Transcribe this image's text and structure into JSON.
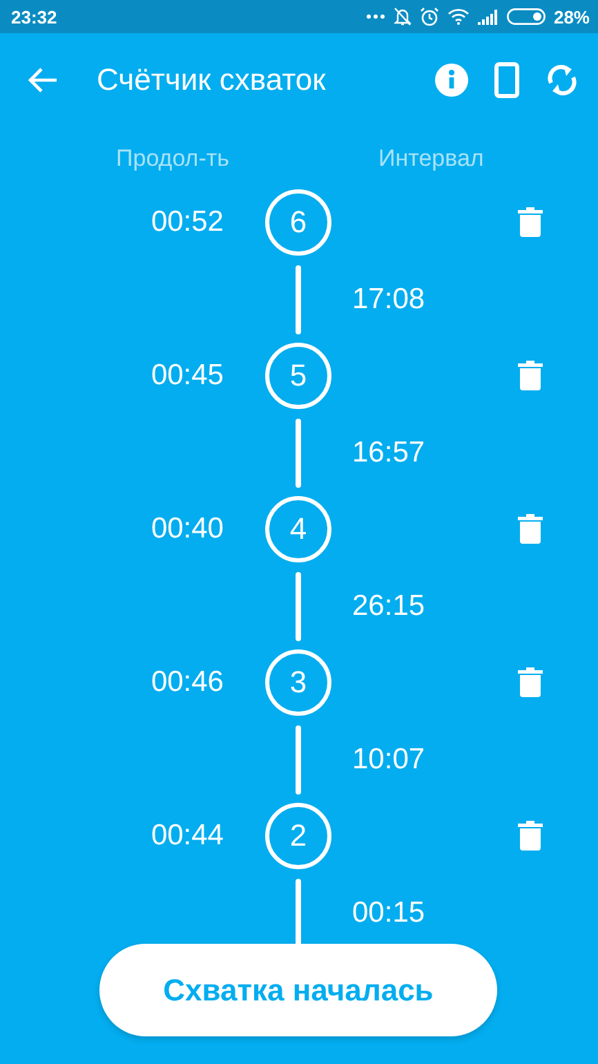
{
  "status_bar": {
    "time": "23:32",
    "battery": "28%"
  },
  "toolbar": {
    "title": "Счётчик схваток"
  },
  "columns": {
    "duration": "Продол-ть",
    "interval": "Интервал"
  },
  "contractions": [
    {
      "number": "6",
      "duration": "00:52",
      "interval": "17:08"
    },
    {
      "number": "5",
      "duration": "00:45",
      "interval": "16:57"
    },
    {
      "number": "4",
      "duration": "00:40",
      "interval": "26:15"
    },
    {
      "number": "3",
      "duration": "00:46",
      "interval": "10:07"
    },
    {
      "number": "2",
      "duration": "00:44",
      "interval": "00:15"
    }
  ],
  "action_button": {
    "label": "Схватка началась"
  }
}
